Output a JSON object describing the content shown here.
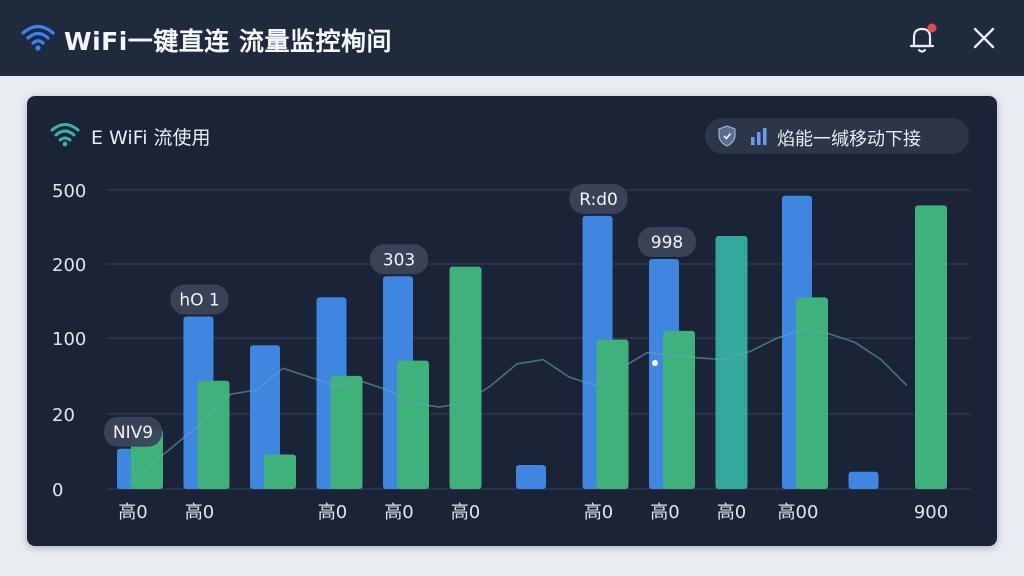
{
  "window": {
    "title": "WiFi一键直连 流量监控栒间",
    "icons": {
      "wifi": "wifi-icon",
      "bell": "bell-icon",
      "close": "close-icon"
    },
    "colors": {
      "titlebar": "#1f2a3d",
      "background": "#e9edf2",
      "notification_dot": "#e5484d"
    }
  },
  "panel": {
    "title": "E WiFi 流使用",
    "chip_label": "焰能一缄移动下接",
    "colors": {
      "panel": "#1b2436",
      "blue": "#3f86e0",
      "green": "#3fb17a",
      "teal": "#34a89a"
    }
  },
  "chart_data": {
    "type": "bar",
    "y_ticks": [
      "500",
      "200",
      "100",
      "20",
      "0"
    ],
    "x_labels": [
      "高0",
      "高0",
      "",
      "高0",
      "高0",
      "高0",
      "",
      "高0",
      "高0",
      "高0",
      "高00",
      "",
      "900"
    ],
    "series": [
      {
        "values": [
          42,
          180,
          150,
          200,
          222,
          null,
          25,
          285,
          240,
          null,
          306,
          18,
          null
        ]
      },
      {
        "values": [
          62,
          113,
          36,
          118,
          134,
          232,
          null,
          156,
          165,
          264,
          200,
          null,
          296
        ]
      }
    ],
    "trend": [
      5,
      30,
      55,
      80,
      110,
      115,
      140,
      130,
      120,
      125,
      115,
      100,
      95,
      100,
      120,
      145,
      150,
      130,
      120,
      140,
      158,
      155,
      152,
      150,
      160,
      175,
      185,
      180,
      170,
      150,
      120
    ],
    "tooltips": [
      {
        "label": "NIV9",
        "bar": 0
      },
      {
        "label": "hO 1",
        "bar": 1
      },
      {
        "label": "303",
        "bar": 4
      },
      {
        "label": "R:d0",
        "bar": 7
      },
      {
        "label": "998",
        "bar": 8
      }
    ]
  }
}
